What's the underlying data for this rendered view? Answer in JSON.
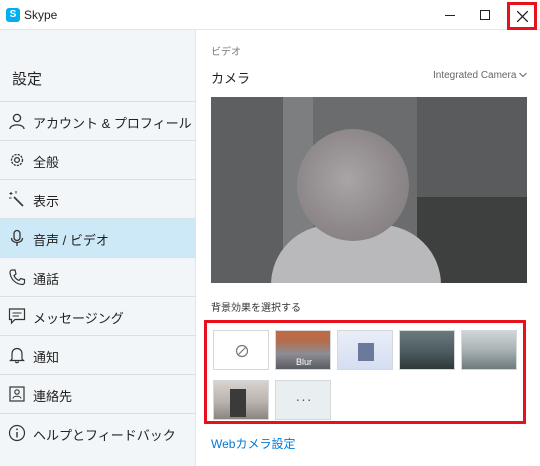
{
  "window": {
    "app_name": "Skype",
    "logo_letter": "S",
    "controls": [
      "minimize",
      "maximize",
      "close"
    ],
    "accent_close_highlight": "#e8101a"
  },
  "sidebar": {
    "title": "設定",
    "items": [
      {
        "label": "アカウント & プロフィール",
        "icon": "person-icon",
        "active": false
      },
      {
        "label": "全般",
        "icon": "gear-icon",
        "active": false
      },
      {
        "label": "表示",
        "icon": "magic-wand-icon",
        "active": false
      },
      {
        "label": "音声 / ビデオ",
        "icon": "microphone-icon",
        "active": true
      },
      {
        "label": "通話",
        "icon": "phone-icon",
        "active": false
      },
      {
        "label": "メッセージング",
        "icon": "chat-icon",
        "active": false
      },
      {
        "label": "通知",
        "icon": "bell-icon",
        "active": false
      },
      {
        "label": "連絡先",
        "icon": "contact-card-icon",
        "active": false
      },
      {
        "label": "ヘルプとフィードバック",
        "icon": "info-icon",
        "active": false
      }
    ],
    "active_color": "#cde8f6"
  },
  "main": {
    "section_label": "ビデオ",
    "camera_heading": "カメラ",
    "camera_selected": "Integrated Camera",
    "background_effects_label": "背景効果を選択する",
    "effects": [
      {
        "name": "none",
        "label": "",
        "icon": "no-effect-icon"
      },
      {
        "name": "blur",
        "label": "Blur"
      },
      {
        "name": "winter",
        "label": ""
      },
      {
        "name": "office-1",
        "label": ""
      },
      {
        "name": "office-2",
        "label": ""
      },
      {
        "name": "room",
        "label": ""
      },
      {
        "name": "more",
        "label": "···"
      }
    ],
    "webcam_link": "Webカメラ設定",
    "link_color": "#0078d4"
  }
}
